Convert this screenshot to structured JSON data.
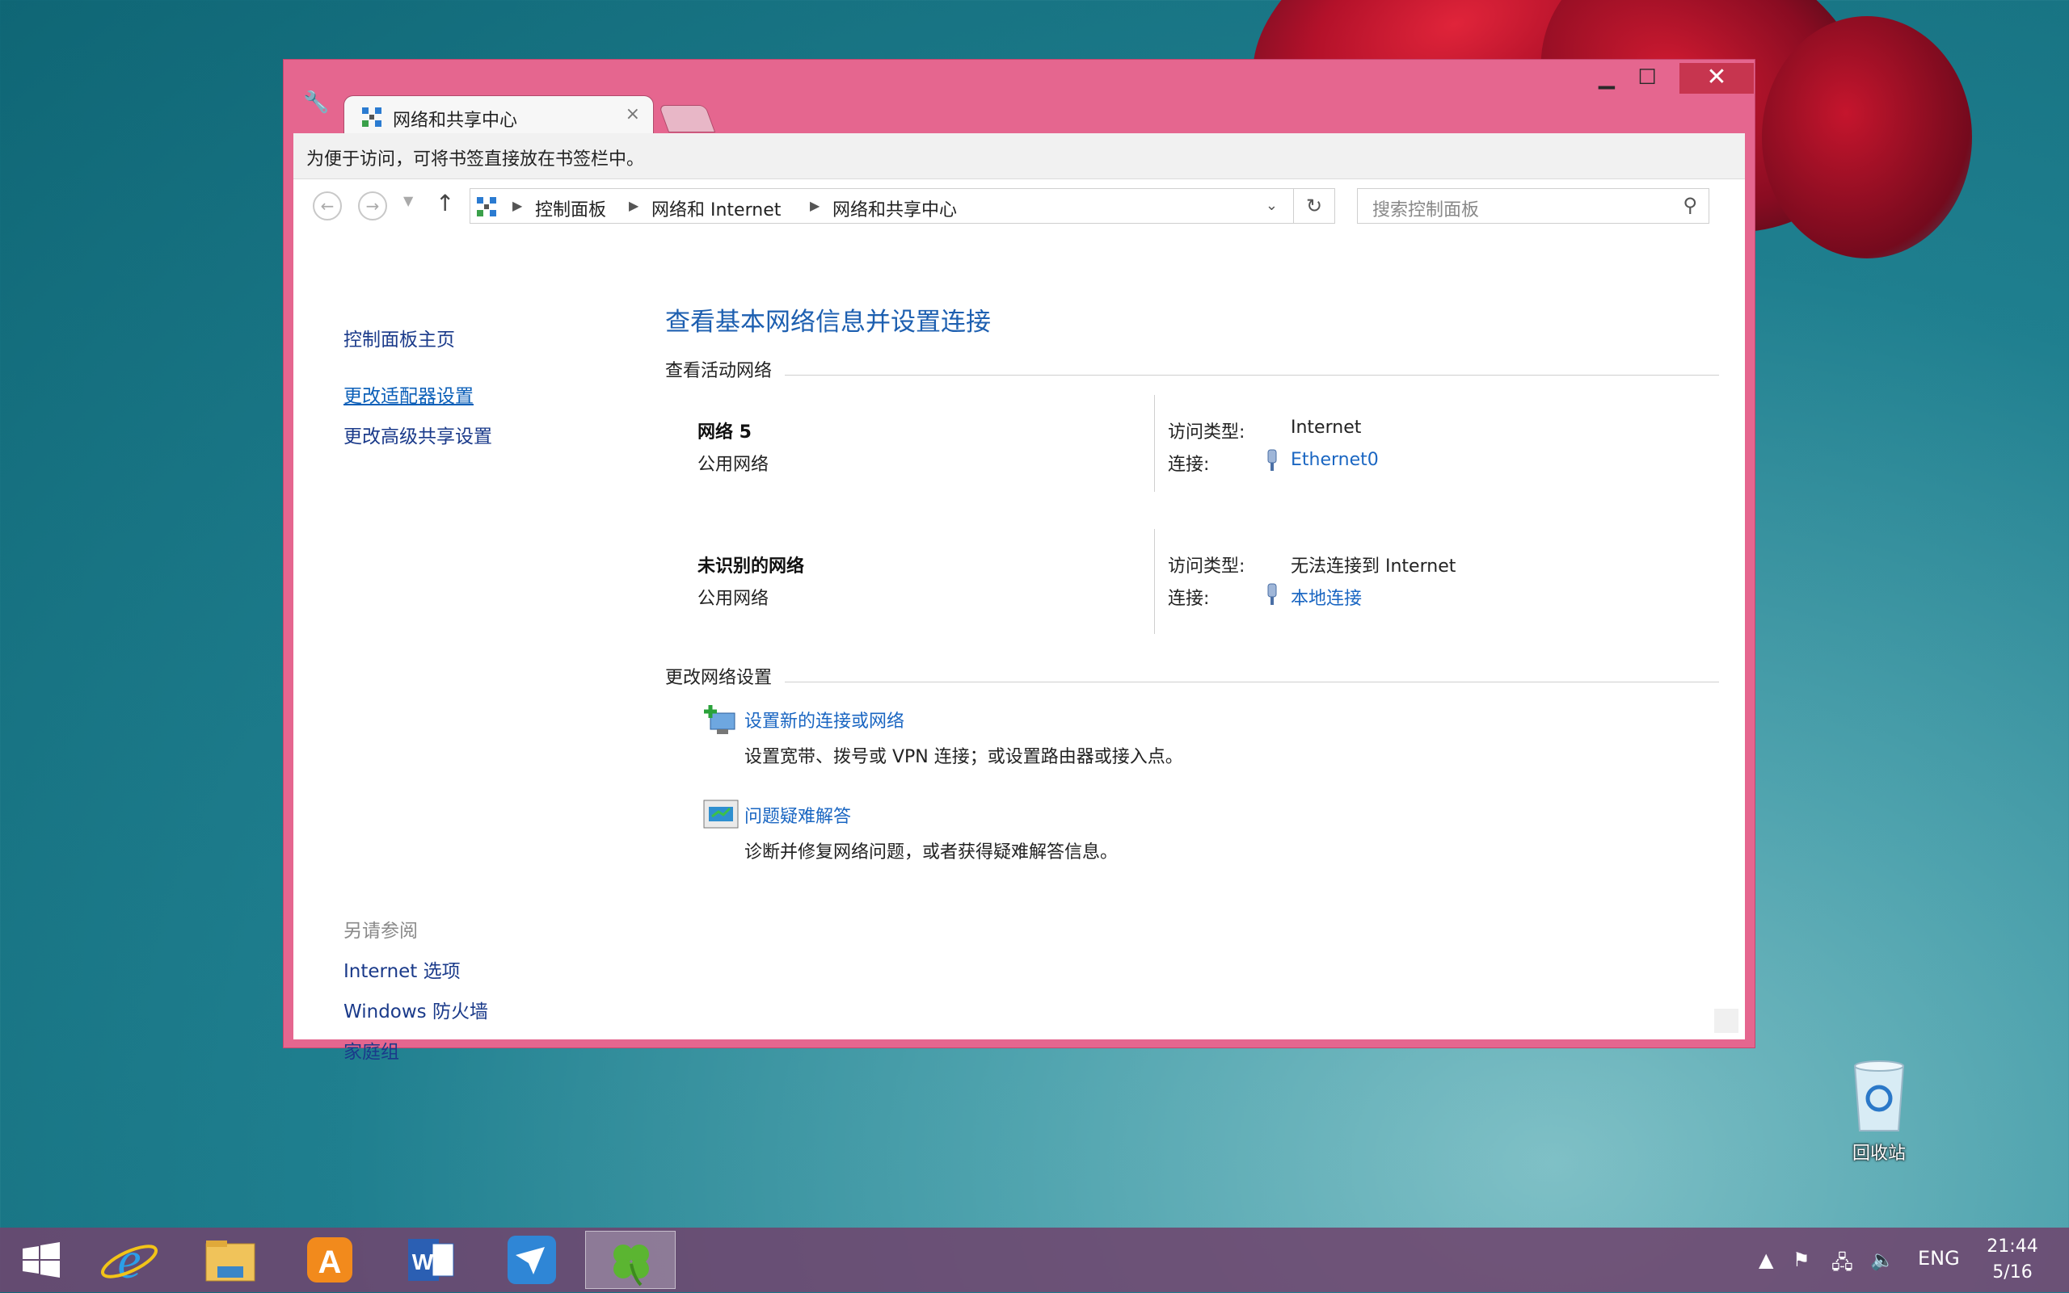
{
  "window": {
    "tab_title": "网络和共享中心",
    "close_glyph": "×",
    "min_glyph": "▁",
    "max_glyph": "☐",
    "winclose_glyph": "✕"
  },
  "bookmarks_bar": {
    "text": "为便于访问，可将书签直接放在书签栏中。"
  },
  "address_bar": {
    "breadcrumbs": [
      "控制面板",
      "网络和 Internet",
      "网络和共享中心"
    ]
  },
  "search": {
    "placeholder": "搜索控制面板"
  },
  "left_pane": {
    "home": "控制面板主页",
    "links": [
      "更改适配器设置",
      "更改高级共享设置"
    ],
    "see_also_heading": "另请参阅",
    "see_also": [
      "Internet 选项",
      "Windows 防火墙",
      "家庭组"
    ]
  },
  "main": {
    "title": "查看基本网络信息并设置连接",
    "active_networks_heading": "查看活动网络",
    "networks": [
      {
        "name": "网络  5",
        "type": "公用网络",
        "access_label": "访问类型:",
        "access_value": "Internet",
        "connection_label": "连接:",
        "connection_value": "Ethernet0"
      },
      {
        "name": "未识别的网络",
        "type": "公用网络",
        "access_label": "访问类型:",
        "access_value": "无法连接到 Internet",
        "connection_label": "连接:",
        "connection_value": "本地连接"
      }
    ],
    "change_settings_heading": "更改网络设置",
    "tasks": [
      {
        "title": "设置新的连接或网络",
        "desc": "设置宽带、拨号或 VPN 连接；或设置路由器或接入点。"
      },
      {
        "title": "问题疑难解答",
        "desc": "诊断并修复网络问题，或者获得疑难解答信息。"
      }
    ]
  },
  "desktop": {
    "recycle_bin_label": "回收站"
  },
  "taskbar": {
    "apps": [
      "start-icon",
      "internet-explorer-icon",
      "file-explorer-icon",
      "app-a-icon",
      "word-icon",
      "bird-app-icon",
      "clover-app-icon"
    ],
    "lang": "ENG",
    "time": "21:44",
    "date": "5/16"
  },
  "colors": {
    "window_frame": "#e5668f",
    "link": "#1a66c2",
    "title": "#1d5fb0"
  }
}
